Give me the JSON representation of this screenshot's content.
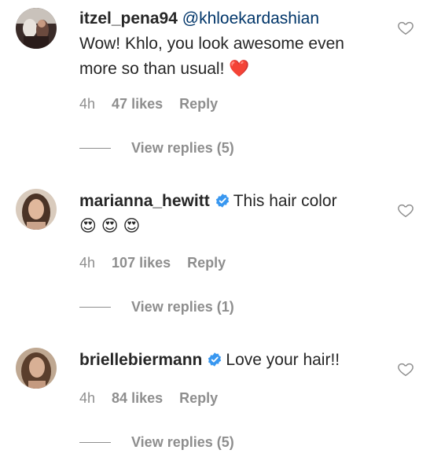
{
  "comments": [
    {
      "username": "itzel_pena94",
      "verified": false,
      "mention": "@khloekardashian",
      "text": "Wow! Khlo, you look awesome even more so than usual! ❤️",
      "time": "4h",
      "likes": "47 likes",
      "reply": "Reply",
      "view_replies": "View replies (5)"
    },
    {
      "username": "marianna_hewitt",
      "verified": true,
      "text": "This hair color",
      "emojis": "😍 😍 😍",
      "time": "4h",
      "likes": "107 likes",
      "reply": "Reply",
      "view_replies": "View replies (1)"
    },
    {
      "username": "briellebiermann",
      "verified": true,
      "text": "Love your hair!!",
      "time": "4h",
      "likes": "84 likes",
      "reply": "Reply",
      "view_replies": "View replies (5)"
    }
  ],
  "colors": {
    "text": "#262626",
    "meta": "#8e8e8e",
    "mention": "#003569",
    "verified": "#3897f0",
    "heart": "#ed4956"
  },
  "icons": {
    "like": "heart-outline-icon",
    "verified": "verified-badge-icon",
    "heart_emoji": "red-heart-icon",
    "emoji": "heart-eyes-emoji-icon"
  }
}
